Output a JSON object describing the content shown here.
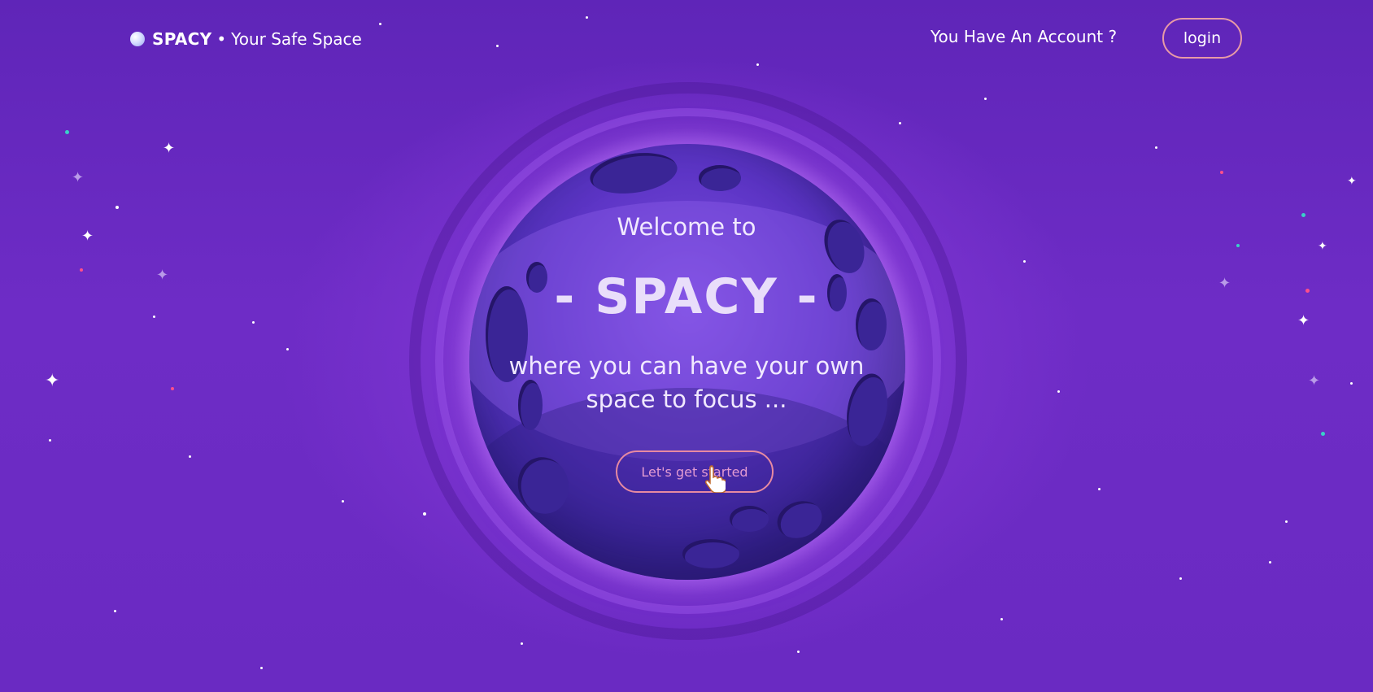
{
  "header": {
    "brand_name": "SPACY",
    "brand_separator": "•",
    "brand_tagline": "Your Safe Space",
    "account_question": "You Have An Account ?",
    "login_label": "login"
  },
  "hero": {
    "welcome": "Welcome to",
    "title": "- SPACY -",
    "tagline_line1": "where you can have your own",
    "tagline_line2": "space to focus ...",
    "cta_label": "Let's get started"
  },
  "colors": {
    "background": "#6a2ac2",
    "planet": "#5d35c6",
    "button_border": "#e78aa1",
    "cta_text": "#e39bd2"
  },
  "icons": [
    "planet-dot-icon",
    "hand-cursor-icon",
    "sparkle-icon"
  ]
}
